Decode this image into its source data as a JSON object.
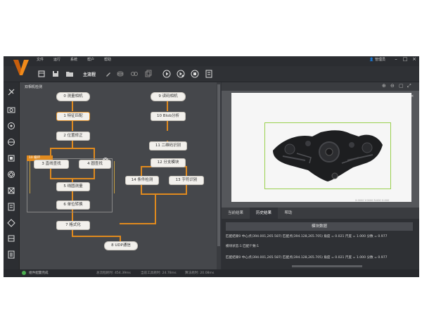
{
  "menu": [
    "文件",
    "运行",
    "系统",
    "帮户",
    "帮助"
  ],
  "user": "管理员",
  "toolbar": {
    "main_flow": "主流程"
  },
  "canvas_title": "双相机检测",
  "loop_label": "10 循环",
  "nodes": {
    "n0": "0 测量相机",
    "n1": "1 特征匹配",
    "n2": "2 位置修正",
    "n3": "3 直线查找",
    "n4": "4 圆查找",
    "n5": "5 线圆测量",
    "n6": "6 单位转换",
    "n7": "7 格式化",
    "n8": "8 UDP通信",
    "n9": "9 读码相机",
    "n10": "10 Blob分析",
    "n11": "11 二维码识别",
    "n12": "12 分支模块",
    "n14": "14 条件检测",
    "n13": "13 字符识别"
  },
  "image": {
    "resolution": "752 × 480",
    "coords": "X:0000 Y:0000 R:000 G:000"
  },
  "tabs": [
    "当前结果",
    "历史结果",
    "帮助"
  ],
  "result": {
    "header": "模块数据",
    "line1": "匹配结果0 中心点(394.001,265.587) 匹配点(394.128,265.705) 角度 = 0.021 尺度 = 1.000 分数 = 0.977",
    "line2": "模块状态:1 匹配个数:1",
    "line3": "匹配结果0 中心点(394.001,265.587) 匹配点(394.128,265.705) 角度 = 0.021 尺度 = 1.000 分数 = 0.977"
  },
  "status": {
    "ok": "组件配置完成",
    "total_time": "总流程耗时: 454.39ms",
    "work_time": "当前工具耗时: 24.78ms",
    "algo_time": "算法耗时: 20.08ms"
  },
  "colors": {
    "accent": "#e08a1e",
    "roi": "#9ad04f"
  }
}
